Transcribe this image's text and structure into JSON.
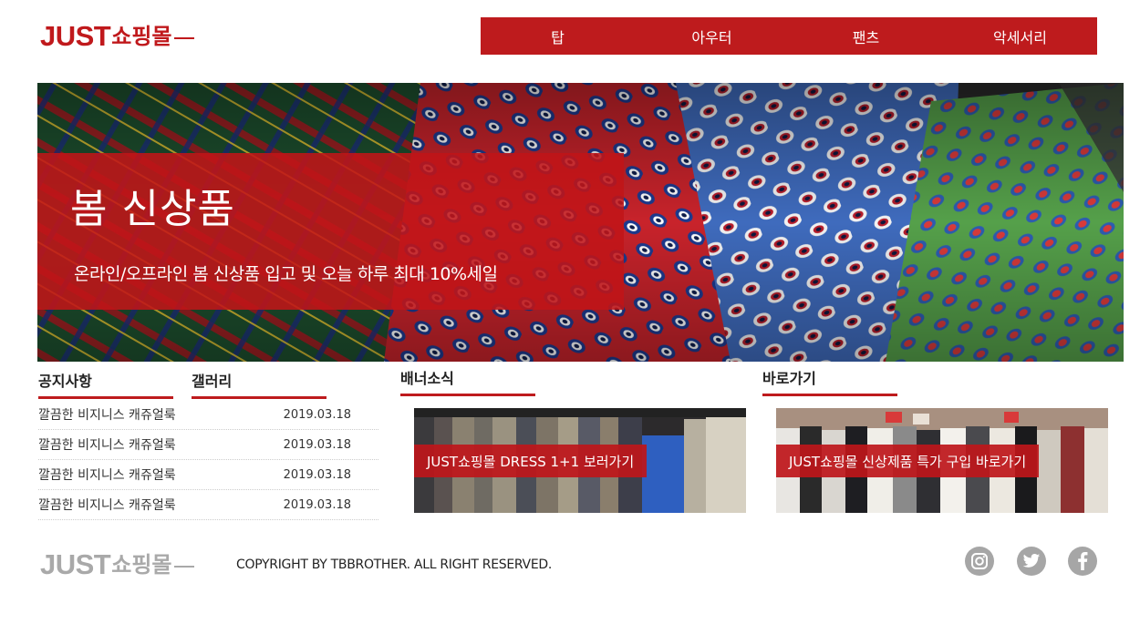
{
  "header": {
    "logo_en": "JUST",
    "logo_ko": "쇼핑몰",
    "nav": [
      "탑",
      "아우터",
      "팬츠",
      "악세서리"
    ]
  },
  "hero": {
    "title": "봄 신상품",
    "subtitle": "온라인/오프라인 봄 신상품 입고 및 오늘 하루 최대 10%세일"
  },
  "tabs": {
    "notice": "공지사항",
    "gallery": "갤러리"
  },
  "notices": [
    {
      "title": "깔끔한 비지니스 캐쥬얼룩",
      "date": "2019.03.18"
    },
    {
      "title": "깔끔한 비지니스 캐쥬얼룩",
      "date": "2019.03.18"
    },
    {
      "title": "깔끔한 비지니스 캐쥬얼룩",
      "date": "2019.03.18"
    },
    {
      "title": "깔끔한 비지니스 캐쥬얼룩",
      "date": "2019.03.18"
    }
  ],
  "banner_section": {
    "title": "배너소식",
    "label": "JUST쇼핑몰 DRESS 1+1 보러가기"
  },
  "shortcut_section": {
    "title": "바로가기",
    "label": "JUST쇼핑몰 신상제품 특가 구입 바로가기"
  },
  "footer": {
    "logo_en": "JUST",
    "logo_ko": "쇼핑몰",
    "copyright": "COPYRIGHT BY TBBROTHER. ALL RIGHT RESERVED.",
    "social": [
      "instagram-icon",
      "twitter-icon",
      "facebook-icon"
    ]
  },
  "colors": {
    "accent": "#be1b1d",
    "footer_gray": "#a9a9a9"
  }
}
